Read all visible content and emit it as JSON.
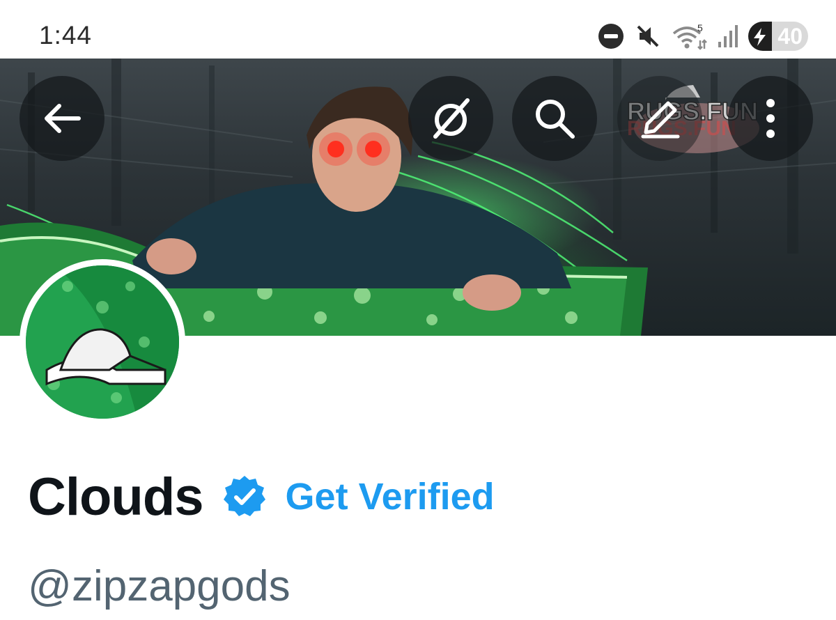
{
  "status_bar": {
    "time": "1:44",
    "network_badge": "5",
    "battery_level": "40"
  },
  "banner": {
    "overlay_text": "RUGS.FUN"
  },
  "nav": {
    "buttons": [
      {
        "name": "back",
        "icon": "arrow-left-icon"
      },
      {
        "name": "grok",
        "icon": "grok-icon"
      },
      {
        "name": "search",
        "icon": "search-icon"
      },
      {
        "name": "edit",
        "icon": "edit-icon"
      },
      {
        "name": "more",
        "icon": "more-vertical-icon"
      }
    ]
  },
  "profile": {
    "display_name": "Clouds",
    "get_verified_label": "Get Verified",
    "handle": "@zipzapgods"
  },
  "colors": {
    "accent": "#1d9bf0",
    "text_primary": "#0f1419",
    "text_secondary": "#536471",
    "banner_glow": "#3cff6a"
  }
}
